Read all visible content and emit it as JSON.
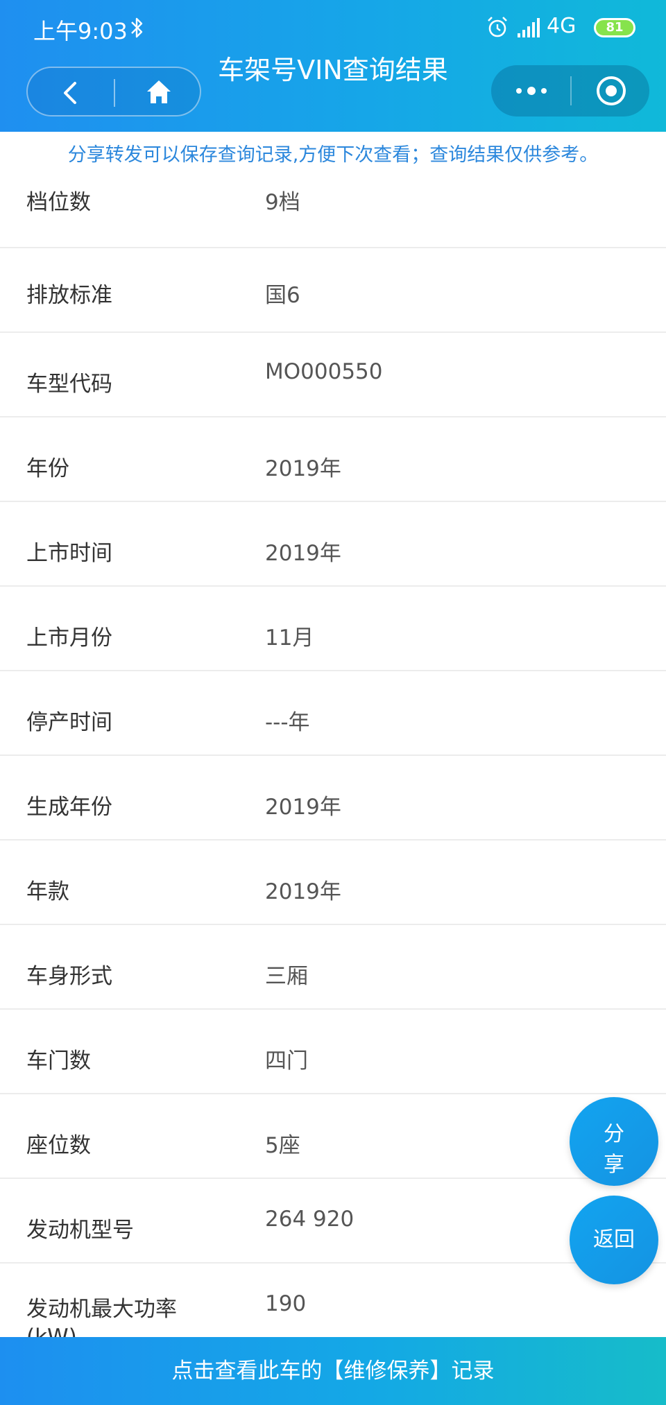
{
  "status_bar": {
    "time": "上午9:03",
    "network": "4G",
    "battery": "81"
  },
  "header": {
    "title": "车架号VIN查询结果"
  },
  "notice": "分享转发可以保存查询记录,方便下次查看；查询结果仅供参考。",
  "rows": [
    {
      "label": "档位数",
      "value": "9档"
    },
    {
      "label": "排放标准",
      "value": "国6"
    },
    {
      "label": "车型代码",
      "value": "MO000550"
    },
    {
      "label": "年份",
      "value": "2019年"
    },
    {
      "label": "上市时间",
      "value": "2019年"
    },
    {
      "label": "上市月份",
      "value": "11月"
    },
    {
      "label": "停产时间",
      "value": "---年"
    },
    {
      "label": "生成年份",
      "value": "2019年"
    },
    {
      "label": "年款",
      "value": "2019年"
    },
    {
      "label": "车身形式",
      "value": "三厢"
    },
    {
      "label": "车门数",
      "value": "四门"
    },
    {
      "label": "座位数",
      "value": "5座"
    },
    {
      "label": "发动机型号",
      "value": "264 920"
    },
    {
      "label": "发动机最大功率(kW)",
      "value": "190"
    }
  ],
  "floating": {
    "share_char1": "分",
    "share_char2": "享",
    "back": "返回"
  },
  "bottom_bar": {
    "label": "点击查看此车的【维修保养】记录"
  },
  "colors": {
    "header_start": "#1f8ff0",
    "header_end": "#10b9d9",
    "notice_text": "#2b87dc",
    "fab": "#12a4f0"
  }
}
